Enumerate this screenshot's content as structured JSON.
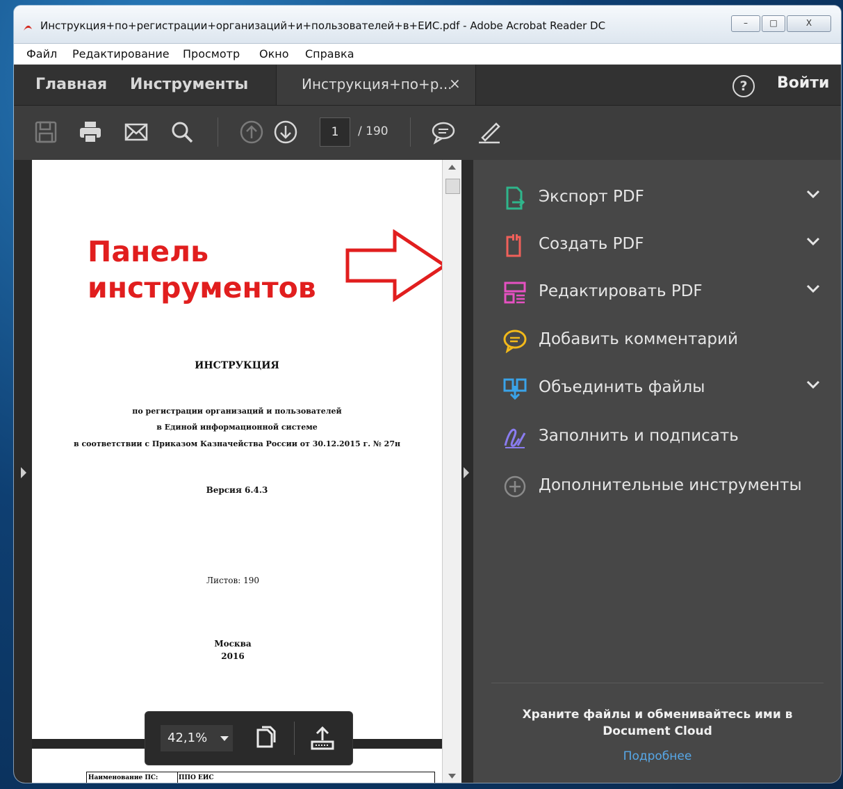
{
  "window": {
    "title": "Инструкция+по+регистрации+организаций+и+пользователей+в+ЕИС.pdf - Adobe Acrobat Reader DC",
    "controls": {
      "minimize": "–",
      "maximize": "□",
      "close": "X"
    }
  },
  "menu": [
    "Файл",
    "Редактирование",
    "Просмотр",
    "Окно",
    "Справка"
  ],
  "nav": {
    "home": "Главная",
    "tools": "Инструменты",
    "doc_tab": "Инструкция+по+р...",
    "doc_tab_close": "×",
    "help": "?",
    "login": "Войти"
  },
  "toolbar": {
    "icons": [
      "save-icon",
      "print-icon",
      "email-icon",
      "search-icon",
      "page-up-icon",
      "page-down-icon",
      "comment-icon",
      "sign-icon"
    ],
    "current_page": "1",
    "total_pages": "/ 190"
  },
  "annotation": {
    "line1": "Панель",
    "line2": "инструментов",
    "color": "#e11e1e"
  },
  "document": {
    "title": "ИНСТРУКЦИЯ",
    "subtitle_1": "по регистрации организаций и пользователей",
    "subtitle_2": "в Единой информационной системе",
    "subtitle_3": "в соответствии с Приказом Казначейства России от 30.12.2015 г. № 27н",
    "version": "Версия 6.4.3",
    "sheets": "Листов: 190",
    "city": "Москва",
    "year": "2016",
    "table_label": "Наименование ПС:",
    "table_value": "ППО ЕИС"
  },
  "zoom": {
    "value": "42,1%"
  },
  "right_panel": {
    "items": [
      {
        "label": "Экспорт PDF",
        "icon": "export-pdf-icon",
        "color": "#2fb58b",
        "expandable": true
      },
      {
        "label": "Создать PDF",
        "icon": "create-pdf-icon",
        "color": "#f0605a",
        "expandable": true
      },
      {
        "label": "Редактировать PDF",
        "icon": "edit-pdf-icon",
        "color": "#e651c2",
        "expandable": true
      },
      {
        "label": "Добавить комментарий",
        "icon": "comment-bubble-icon",
        "color": "#f2b91a",
        "expandable": false
      },
      {
        "label": "Объединить файлы",
        "icon": "combine-files-icon",
        "color": "#3aa3e8",
        "expandable": true
      },
      {
        "label": "Заполнить и подписать",
        "icon": "fill-sign-icon",
        "color": "#8a7cf0",
        "expandable": false
      },
      {
        "label": "Дополнительные инструменты",
        "icon": "add-tools-icon",
        "color": "#8a8a8a",
        "expandable": false
      }
    ],
    "promo": "Храните файлы и обменивайтесь ими в Document Cloud",
    "more_link": "Подробнее"
  }
}
